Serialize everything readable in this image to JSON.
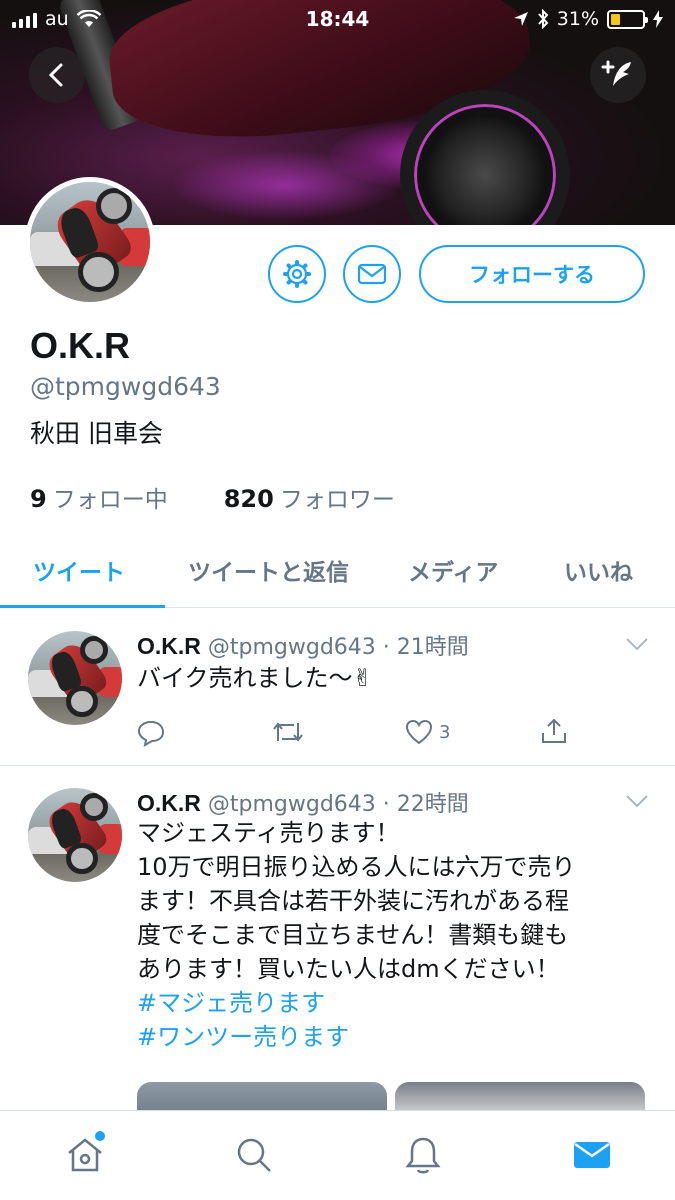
{
  "status_bar": {
    "carrier": "au",
    "time": "18:44",
    "battery": "31%"
  },
  "profile": {
    "name": "O.K.R",
    "handle": "@tpmgwgd643",
    "bio": "秋田 旧車会",
    "following_count": "9",
    "following_label": "フォロー中",
    "followers_count": "820",
    "followers_label": "フォロワー",
    "follow_button": "フォローする"
  },
  "tabs": [
    {
      "label": "ツイート",
      "active": true
    },
    {
      "label": "ツイートと返信",
      "active": false
    },
    {
      "label": "メディア",
      "active": false
    },
    {
      "label": "いいね",
      "active": false
    }
  ],
  "tweets": [
    {
      "name": "O.K.R",
      "meta": "@tpmgwgd643 · 21時間",
      "text": "バイク売れました〜✌",
      "likes": "3"
    },
    {
      "name": "O.K.R",
      "meta": "@tpmgwgd643 · 22時間",
      "lines": [
        "マジェスティ売ります！",
        "10万で明日振り込める人には六万で売り",
        "ます！不具合は若干外装に汚れがある程",
        "度でそこまで目立ちません！書類も鍵も",
        "あります！買いたい人はdmください！"
      ],
      "hashtags": [
        "#マジェ売ります",
        "#ワンツー売ります"
      ]
    }
  ],
  "colors": {
    "accent": "#1da1f2",
    "muted": "#657786",
    "text": "#14171a",
    "battery_fill": "#f5c518"
  },
  "icons": [
    "back-icon",
    "compose-icon",
    "settings-icon",
    "mail-icon",
    "reply-icon",
    "retweet-icon",
    "like-icon",
    "share-icon",
    "chevron-down-icon",
    "home-icon",
    "search-icon",
    "notifications-icon",
    "messages-icon"
  ]
}
